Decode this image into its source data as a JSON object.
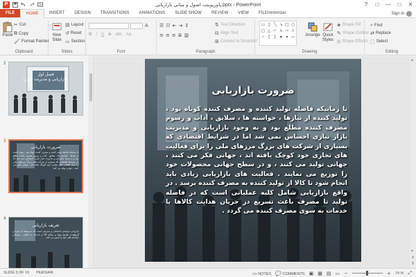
{
  "window": {
    "title": "پاورپوینت اصول و مبانی بازاریابی.pptx - PowerPoint",
    "app_icon": "P",
    "controls": [
      "?",
      "□",
      "—",
      "□",
      "✕"
    ]
  },
  "tabs": {
    "file": "FILE",
    "items": [
      "HOME",
      "INSERT",
      "DESIGN",
      "TRANSITIONS",
      "ANIMATIONS",
      "SLIDE SHOW",
      "REVIEW",
      "VIEW",
      "FILEminimizer"
    ],
    "active": "HOME",
    "signin": "Sign in"
  },
  "ribbon": {
    "clipboard": {
      "label": "Clipboard",
      "paste": "Paste",
      "cut": "Cut",
      "copy": "Copy",
      "format_painter": "Format Painter"
    },
    "slides": {
      "label": "Slides",
      "new_slide_1": "New",
      "new_slide_2": "Slide",
      "layout": "Layout",
      "reset": "Reset",
      "section": "Section"
    },
    "font": {
      "label": "Font",
      "bold": "B",
      "italic": "I",
      "underline": "U",
      "strike": "S",
      "shadow": "abc",
      "case": "Aa"
    },
    "paragraph": {
      "label": "Paragraph",
      "text_direction": "Text Direction",
      "align_text": "Align Text",
      "convert_smartart": "Convert to SmartArt"
    },
    "drawing": {
      "label": "Drawing",
      "arrange": "Arrange",
      "quick_styles_1": "Quick",
      "quick_styles_2": "Styles",
      "shape_fill": "Shape Fill",
      "shape_outline": "Shape Outline",
      "shape_effects": "Shape Effects"
    },
    "editing": {
      "label": "Editing",
      "find": "Find",
      "replace": "Replace",
      "select": "Select"
    }
  },
  "thumbnails": [
    {
      "num": "2",
      "title": "فصل اول\n(بازاریابی و مدیریت بازار)",
      "text": ""
    },
    {
      "num": "3",
      "title": "ضرورت بازاریابی",
      "text": "تا زمانیکه فاصله تولید کننده و مصرف کننده کوتاه بود ، تولید کننده از نیازها ، خواسته ها ، سلایق ، آداب و رسوم مصرف کننده مطلع بود و به وجود بازاریابی و مدیریت بازار نیازی احساس نمی شد اما در شرایط اقتصادی که بسیاری از شرکت های بزرگ مرزهای ملی را برای فعالیت های تجاری خود کوچک یافته اند ، جهانی فکر می کنند ، جهانی تولید می کنند",
      "current": true
    },
    {
      "num": "4",
      "title": "تعریف بازاریابی",
      "text": "بازاریابی فرایندی اجتماعی و مدیریتی است که به وسیله آن افراد و گروهها از طریق تولید و مبادله کالا و خدمات با دیگران ، نیازها و خواسته های خود را تامین می کنند"
    }
  ],
  "slide": {
    "title": "ضرورت بازاریابی",
    "body": "تا زمانیکه فاصله تولید کننده و مصرف کننده کوتاه بود ، تولید کننده از نیازها ، خواسته ها ، سلایق ، آداب و رسوم مصرف کننده مطلع بود و به وجود بازاریابی و مدیریت بازار نیازی احساس نمی شد اما در شرایط اقتصادی که بسیاری از شرکت های بزرگ مرزهای ملی را برای فعالیت های تجاری خود کوچک یافته اند ، جهانی فکر می کنند ، جهانی تولید می کنند ، و در سطح جهانی محصولات خود را توزیع می نمایند . فعالیت های بازاریابی زیادی باید انجام شود تا کالا از تولید کننده به مصرف کننده برسد . در واقع بازاریابی شامل کلیه عملیاتی است که در فاصله تولید تا مصرف باعث تسریع در جریان هدایت کالاها یا خدمات به سوی مصرف کننده می گردد ."
  },
  "status": {
    "slide_info": "SLIDE 3 OF 16",
    "language": "PERSIAN",
    "notes": "NOTES",
    "comments": "COMMENTS",
    "zoom": "74 %"
  },
  "colors": {
    "accent": "#d24726",
    "slide_bg": "#2f3c44"
  }
}
